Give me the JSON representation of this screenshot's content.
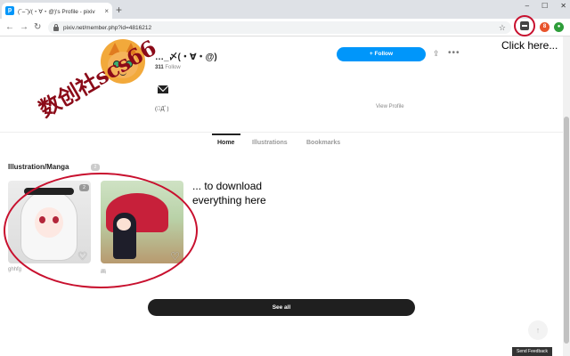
{
  "browser": {
    "tab_title": "(‾⌣‾)/(・∀・@)'s Profile - pixiv",
    "tab_close": "×",
    "new_tab": "+",
    "window_buttons": [
      "–",
      "☐",
      "✕"
    ],
    "nav": {
      "back": "←",
      "forward": "→",
      "reload": "↻"
    },
    "url": "pixiv.net/member.php?id=4816212",
    "star": "☆",
    "extension_badge": "8"
  },
  "profile": {
    "username": "…_〆(・∀・@)",
    "follow_count": "311",
    "follow_label": "Follow",
    "follow_button": "+ Follow",
    "share": "⇪",
    "more": "•••",
    "bio": "(ﾟДﾟ)",
    "view_profile": "View Profile"
  },
  "tabs": [
    {
      "label": "Home"
    },
    {
      "label": "Illustrations"
    },
    {
      "label": "Bookmarks"
    }
  ],
  "section": {
    "title": "Illustration/Manga",
    "count": "2"
  },
  "works": [
    {
      "count": "2",
      "owner": "ghhfg"
    },
    {
      "count": "",
      "owner": "画"
    }
  ],
  "heart": "♡",
  "see_all": "See all",
  "scroll_top": "↑",
  "feedback": "Send Feedback",
  "annotations": {
    "click_here": "Click here...",
    "download_line1": "... to download",
    "download_line2": "everything here",
    "watermark": "数创社scs66"
  }
}
